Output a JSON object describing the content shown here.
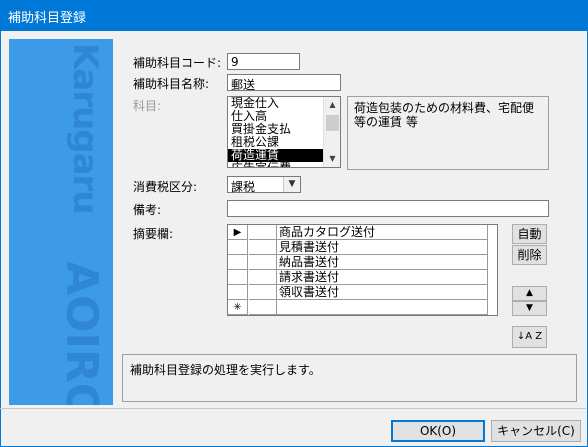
{
  "window": {
    "title": "補助科目登録"
  },
  "brand": {
    "top_text": "Karugaru",
    "bottom_text": "AOIRO"
  },
  "form": {
    "code_label": "補助科目コード:",
    "code_value": "9",
    "name_label": "補助科目名称:",
    "name_value": "郵送",
    "account_label": "科目:",
    "account_items": [
      "現金仕入",
      "仕入高",
      "買掛金支払",
      "租税公課",
      "荷造運賃",
      "広告宣伝費"
    ],
    "account_selected_index": 4,
    "account_description": "荷造包装のための材料費、宅配便等の運賃 等",
    "tax_label": "消費税区分:",
    "tax_value": "課税",
    "remarks_label": "備考:",
    "remarks_value": "",
    "summary_label": "摘要欄:"
  },
  "summary_grid": {
    "rows": [
      {
        "selector": "▶",
        "text": "商品カタログ送付"
      },
      {
        "selector": "",
        "text": "見積書送付"
      },
      {
        "selector": "",
        "text": "納品書送付"
      },
      {
        "selector": "",
        "text": "請求書送付"
      },
      {
        "selector": "",
        "text": "領収書送付"
      },
      {
        "selector": "✳",
        "text": ""
      }
    ]
  },
  "side_buttons": {
    "auto": "自動",
    "delete": "削除",
    "up": "▲",
    "down": "▼",
    "sort": "↓A Z"
  },
  "status_message": "補助科目登録の処理を実行します。",
  "footer": {
    "ok": "OK(O)",
    "cancel": "キャンセル(C)"
  },
  "colors": {
    "titlebar": "#0078d7",
    "side_panel": "#3c9ae8",
    "brand_text": "#2f86d2"
  }
}
